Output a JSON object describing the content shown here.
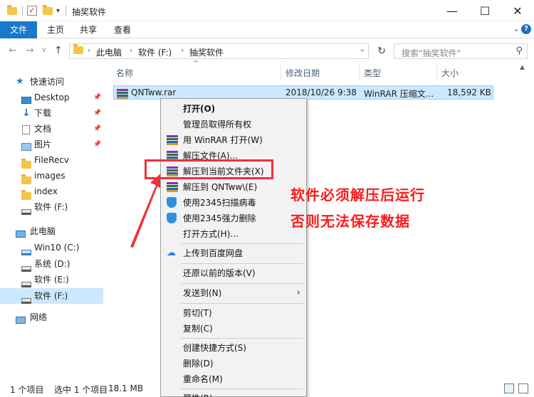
{
  "window": {
    "title": "抽奖软件"
  },
  "ribbon": {
    "tabs": [
      "文件",
      "主页",
      "共享",
      "查看"
    ]
  },
  "address": {
    "crumbs": [
      "此电脑",
      "软件 (F:)",
      "抽奖软件"
    ]
  },
  "search": {
    "placeholder": "搜索\"抽奖软件\""
  },
  "sidebar": {
    "items": [
      {
        "label": "快速访问",
        "icon": "star-icon"
      },
      {
        "label": "Desktop",
        "icon": "desktop-icon"
      },
      {
        "label": "下载",
        "icon": "download-icon"
      },
      {
        "label": "文档",
        "icon": "document-icon"
      },
      {
        "label": "图片",
        "icon": "picture-icon"
      },
      {
        "label": "FileRecv",
        "icon": "folder-icon"
      },
      {
        "label": "images",
        "icon": "folder-icon"
      },
      {
        "label": "index",
        "icon": "folder-icon"
      },
      {
        "label": "软件 (F:)",
        "icon": "drive-icon"
      },
      {
        "label": "此电脑",
        "icon": "computer-icon"
      },
      {
        "label": "Win10 (C:)",
        "icon": "windows-drive-icon"
      },
      {
        "label": "系统 (D:)",
        "icon": "drive-icon"
      },
      {
        "label": "软件 (E:)",
        "icon": "drive-icon"
      },
      {
        "label": "软件 (F:)",
        "icon": "drive-icon"
      },
      {
        "label": "网络",
        "icon": "network-icon"
      }
    ],
    "selected": "软件 (F:)"
  },
  "table": {
    "columns": [
      "名称",
      "修改日期",
      "类型",
      "大小"
    ],
    "rows": [
      {
        "name": "QNTww.rar",
        "modified": "2018/10/26 9:38",
        "type": "WinRAR 压缩文...",
        "size": "18,592 KB"
      }
    ]
  },
  "context_menu": {
    "items": [
      "打开(O)",
      "管理员取得所有权",
      "用 WinRAR 打开(W)",
      "解压文件(A)...",
      "解压到当前文件夹(X)",
      "解压到 QNTww\\(E)",
      "使用2345扫描病毒",
      "使用2345强力删除",
      "打开方式(H)...",
      "上传到百度网盘",
      "还原以前的版本(V)",
      "发送到(N)",
      "剪切(T)",
      "复制(C)",
      "创建快捷方式(S)",
      "删除(D)",
      "重命名(M)",
      "属性(R)"
    ],
    "highlighted": "解压到当前文件夹(X)"
  },
  "annotation": {
    "line1": "软件必须解压后运行",
    "line2": "否则无法保存数据"
  },
  "status": {
    "count": "1 个项目",
    "selected": "选中 1 个项目",
    "size": "18.1 MB"
  },
  "colors": {
    "accent": "#1979ca",
    "selection": "#cce8ff",
    "annotation": "#ff1a1a"
  }
}
